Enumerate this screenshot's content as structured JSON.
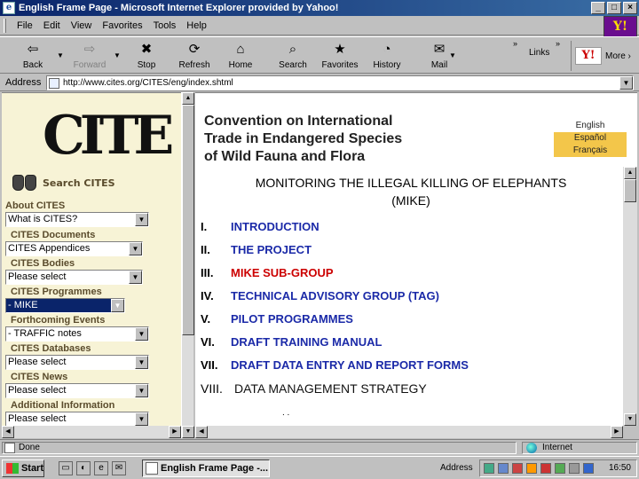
{
  "window": {
    "title": "English Frame Page - Microsoft Internet Explorer provided by Yahoo!",
    "controls": [
      "_",
      "□",
      "×"
    ]
  },
  "menu": [
    "File",
    "Edit",
    "View",
    "Favorites",
    "Tools",
    "Help"
  ],
  "brand_badge": "Y!",
  "toolbar": {
    "buttons": [
      {
        "label": "Back",
        "icon": "back-arrow-icon",
        "glyph": "⇦",
        "enabled": true
      },
      {
        "label": "Forward",
        "icon": "forward-arrow-icon",
        "glyph": "⇨",
        "enabled": false
      },
      {
        "label": "Stop",
        "icon": "stop-icon",
        "glyph": "✖",
        "enabled": true
      },
      {
        "label": "Refresh",
        "icon": "refresh-icon",
        "glyph": "⟳",
        "enabled": true
      },
      {
        "label": "Home",
        "icon": "home-icon",
        "glyph": "⌂",
        "enabled": true
      },
      {
        "label": "Search",
        "icon": "search-icon",
        "glyph": "⌕",
        "enabled": true
      },
      {
        "label": "Favorites",
        "icon": "favorites-icon",
        "glyph": "★",
        "enabled": true
      },
      {
        "label": "History",
        "icon": "history-icon",
        "glyph": "◔",
        "enabled": true
      },
      {
        "label": "Mail",
        "icon": "mail-icon",
        "glyph": "✉",
        "enabled": true
      }
    ],
    "links_label": "Links",
    "more_label": "More ›",
    "yahoo_logo": "Y!"
  },
  "address": {
    "label": "Address",
    "url": "http://www.cites.org/CITES/eng/index.shtml"
  },
  "left_frame": {
    "logo_text": "CITES",
    "search_link": "Search CITES",
    "sections": [
      {
        "label": "About CITES",
        "select": "What is CITES?"
      },
      {
        "label": "CITES Documents",
        "select": "CITES Appendices"
      },
      {
        "label": "CITES Bodies",
        "select": "Please select"
      },
      {
        "label": "CITES Programmes",
        "select": "- MIKE"
      },
      {
        "label": "Forthcoming Events",
        "select": "- TRAFFIC notes"
      },
      {
        "label": "CITES Databases",
        "select": "Please select"
      },
      {
        "label": "CITES News",
        "select": "Please select"
      },
      {
        "label": "Additional Information",
        "select": "Please select"
      }
    ]
  },
  "banner": {
    "title_lines": [
      "Convention on International",
      "Trade in Endangered Species",
      "of Wild Fauna and Flora"
    ],
    "languages": [
      "English",
      "Español",
      "Français"
    ]
  },
  "document": {
    "heading_line1": "MONITORING  THE  ILLEGAL  KILLING OF   ELEPHANTS",
    "heading_line2": "(MIKE)",
    "toc": [
      {
        "num": "I.",
        "text": "INTRODUCTION"
      },
      {
        "num": "II.",
        "text": "THE  PROJECT"
      },
      {
        "num": "III.",
        "text": "MIKE  SUB-GROUP"
      },
      {
        "num": "IV.",
        "text": "TECHNICAL  ADVISORY  GROUP  (TAG)"
      },
      {
        "num": "V.",
        "text": "PILOT  PROGRAMMES"
      },
      {
        "num": "VI.",
        "text": "DRAFT  TRAINING  MANUAL"
      },
      {
        "num": "VII.",
        "text": "DRAFT  DATA  ENTRY  AND  REPORT  FORMS"
      },
      {
        "num": "VIII.",
        "text": "DATA  MANAGEMENT  STRATEGY"
      }
    ],
    "current_index": 2,
    "footer_dots": ". ."
  },
  "status": {
    "text": "Done",
    "zone": "Internet"
  },
  "taskbar": {
    "start": "Start",
    "task": "English Frame Page -...",
    "address": "Address",
    "clock": "16:50"
  },
  "colors": {
    "titlebar": "#0a246a",
    "link_blue": "#1b2aa8",
    "current_red": "#cc0000",
    "left_bg": "#f7f3d6",
    "label_brown": "#5a4b2c",
    "lang_highlight": "#f3c64a"
  }
}
